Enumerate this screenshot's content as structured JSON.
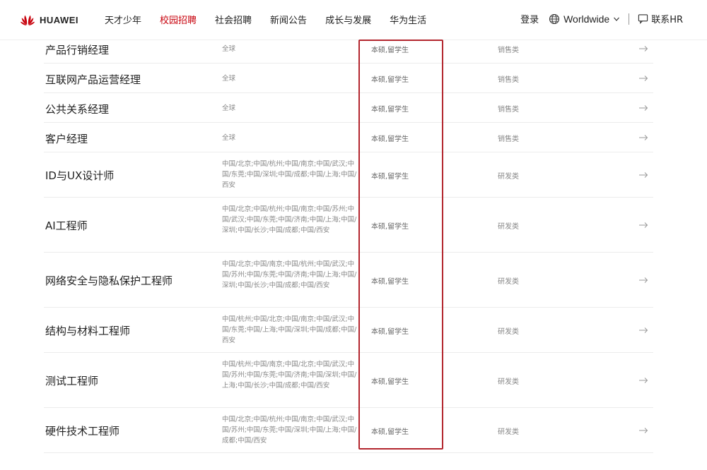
{
  "header": {
    "brand": "HUAWEI",
    "nav": [
      "天才少年",
      "校园招聘",
      "社会招聘",
      "新闻公告",
      "成长与发展",
      "华为生活"
    ],
    "active_index": 1,
    "login": "登录",
    "region": "Worldwide",
    "contact": "联系HR"
  },
  "colors": {
    "brand_red": "#c7000b",
    "highlight": "#b3262e"
  },
  "jobs": [
    {
      "title": "产品行销经理",
      "locations": "全球",
      "education": "本硕,留学生",
      "category": "销售类"
    },
    {
      "title": "互联网产品运营经理",
      "locations": "全球",
      "education": "本硕,留学生",
      "category": "销售类"
    },
    {
      "title": "公共关系经理",
      "locations": "全球",
      "education": "本硕,留学生",
      "category": "销售类"
    },
    {
      "title": "客户经理",
      "locations": "全球",
      "education": "本硕,留学生",
      "category": "销售类"
    },
    {
      "title": "ID与UX设计师",
      "locations": "中国/北京;中国/杭州;中国/南京;中国/武汉;中国/东莞;中国/深圳;中国/成都;中国/上海;中国/西安",
      "education": "本硕,留学生",
      "category": "研发类"
    },
    {
      "title": "AI工程师",
      "locations": "中国/北京;中国/杭州;中国/南京;中国/苏州;中国/武汉;中国/东莞;中国/济南;中国/上海;中国/深圳;中国/长沙;中国/成都;中国/西安",
      "education": "本硕,留学生",
      "category": "研发类"
    },
    {
      "title": "网络安全与隐私保护工程师",
      "locations": "中国/北京;中国/南京;中国/杭州;中国/武汉;中国/苏州;中国/东莞;中国/济南;中国/上海;中国/深圳;中国/长沙;中国/成都;中国/西安",
      "education": "本硕,留学生",
      "category": "研发类"
    },
    {
      "title": "结构与材料工程师",
      "locations": "中国/杭州;中国/北京;中国/南京;中国/武汉;中国/东莞;中国/上海;中国/深圳;中国/成都;中国/西安",
      "education": "本硕,留学生",
      "category": "研发类"
    },
    {
      "title": "测试工程师",
      "locations": "中国/杭州;中国/南京;中国/北京;中国/武汉;中国/苏州;中国/东莞;中国/济南;中国/深圳;中国/上海;中国/长沙;中国/成都;中国/西安",
      "education": "本硕,留学生",
      "category": "研发类"
    },
    {
      "title": "硬件技术工程师",
      "locations": "中国/北京;中国/杭州;中国/南京;中国/武汉;中国/苏州;中国/东莞;中国/深圳;中国/上海;中国/成都;中国/西安",
      "education": "本硕,留学生",
      "category": "研发类"
    }
  ]
}
